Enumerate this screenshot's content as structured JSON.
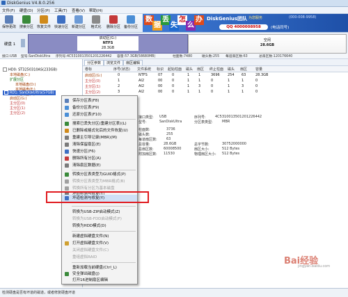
{
  "window": {
    "title": "DiskGenius V4.8.0.256"
  },
  "menu": [
    "文件(F)",
    "硬盘(D)",
    "分区(P)",
    "工具(T)",
    "查看(V)",
    "帮助(H)"
  ],
  "toolbar": [
    {
      "label": "保存更改",
      "icon": "save-icon",
      "color": "#5b7fb8"
    },
    {
      "label": "搜索分区",
      "icon": "search-partition-icon",
      "color": "#3a8a3a"
    },
    {
      "label": "恢复文件",
      "icon": "recover-files-icon",
      "color": "#d08a1a"
    },
    {
      "label": "快速分区",
      "icon": "quick-partition-icon",
      "color": "#3d6fc2"
    },
    {
      "label": "新建分区",
      "icon": "new-partition-icon",
      "color": "#6c9ad6"
    },
    {
      "label": "格式化",
      "icon": "format-icon",
      "color": "#8a8a8a"
    },
    {
      "label": "删除分区",
      "icon": "delete-partition-icon",
      "color": "#c43a3a"
    },
    {
      "label": "备份分区",
      "icon": "backup-partition-icon",
      "color": "#4a8ed6"
    }
  ],
  "banner": {
    "tiles": [
      "数",
      "据",
      "丢",
      "失",
      "怎",
      "么",
      "办"
    ],
    "brand": "DiskGenius团队",
    "sub": "为您服务",
    "qq_prefix": "QQ",
    "qq": "4000008958",
    "tel": "(电话同号)",
    "tel_small": "(000-008-9958)"
  },
  "diskmap": {
    "disk_label": "硬盘 1",
    "part1": {
      "name": "启动区(G:)",
      "fs": "NTFS",
      "size": "28.3GB"
    },
    "part2": {
      "name": "空闲",
      "size": "28.6GB"
    }
  },
  "infobar": [
    "接口:USB",
    "型号:SanDiskUltra",
    "序列号:4C5310013501201226442",
    "容量:57.3GB(58680MB)",
    "柱面数:7480",
    "磁头数:255",
    "每道扇区数:63",
    "总扇区数:120176640"
  ],
  "tree": {
    "disk0": "HD0: ST3250310AS(233GB)",
    "d0_items": [
      "本地磁盘(C:)",
      "扩展分区",
      "本地磁盘(D:)",
      "本地磁盘(E:)",
      "本地磁盘(F:)"
    ],
    "disk1": "RD1: SanDiskUltra(57GB)",
    "d1_items": [
      "启动区(G:)",
      "主分区(0)",
      "主分区(1)",
      "主分区(2)"
    ]
  },
  "tabs": [
    "分区参数",
    "浏览文件",
    "扇区编辑"
  ],
  "table": {
    "headers": [
      "卷标",
      "序号(状态)",
      "文件系统",
      "标识",
      "起始柱面",
      "磁头",
      "扇区",
      "终止柱面",
      "磁头",
      "扇区",
      "容量"
    ],
    "rows": [
      [
        "启动区(G:)",
        "0",
        "NTFS",
        "07",
        "0",
        "1",
        "1",
        "3696",
        "254",
        "63",
        "28.3GB"
      ],
      [
        "主分区(0)",
        "1",
        "AI2",
        "00",
        "0",
        "1",
        "1",
        "0",
        "1",
        "1",
        "0"
      ],
      [
        "主分区(1)",
        "2",
        "AI2",
        "00",
        "0",
        "1",
        "3",
        "0",
        "1",
        "3",
        "0"
      ],
      [
        "主分区(2)",
        "3",
        "AI2",
        "00",
        "0",
        "1",
        "1",
        "0",
        "1",
        "1",
        "0"
      ]
    ]
  },
  "details": [
    {
      "l": "接口类型:",
      "v": "USB"
    },
    {
      "l": "型号:",
      "v": "SanDiskUltra"
    },
    {
      "l": "柱面数:",
      "v": "3736"
    },
    {
      "l": "磁头数:",
      "v": "255"
    },
    {
      "l": "每道扇区数:",
      "v": "63"
    },
    {
      "l": "总容量:",
      "v": "28.6GB"
    },
    {
      "l": "总扇区数:",
      "v": "60008500"
    },
    {
      "l": "附加扇区数:",
      "v": "11530"
    },
    {
      "l": "序列号:",
      "v": "4C5310013501201226442"
    },
    {
      "l": "分区表类型:",
      "v": "MBR"
    },
    {
      "l": "总字节数:",
      "v": "30752000000"
    },
    {
      "l": "扇区大小:",
      "v": "512 Bytes"
    },
    {
      "l": "物理扇区大小:",
      "v": "512 Bytes"
    }
  ],
  "context_menu": [
    {
      "label": "保存分区表(F8)",
      "enabled": true,
      "icon": "save-icon",
      "color": "#5b7fb8"
    },
    {
      "label": "备份分区表(F9)",
      "enabled": true,
      "icon": "backup-icon",
      "color": "#4a8ed6"
    },
    {
      "label": "还原分区表(F10)",
      "enabled": true,
      "icon": "restore-icon",
      "color": "#4a8ed6"
    },
    {
      "sep": true
    },
    {
      "label": "搜索已丢失分区(重建分区表)(L)",
      "enabled": true,
      "icon": "search-icon",
      "color": "#3a8a3a"
    },
    {
      "label": "已删除或格式化后的文件恢复(U)",
      "enabled": true,
      "icon": "recover-icon",
      "color": "#d08a1a"
    },
    {
      "label": "重建主引导记录(MBR)(M)",
      "enabled": true,
      "icon": "mbr-icon",
      "color": "#7a7a7a"
    },
    {
      "label": "清除保留扇区(E)",
      "enabled": true,
      "icon": "clear-icon",
      "color": "#7a7a7a"
    },
    {
      "label": "快速分区(F6)",
      "enabled": true,
      "icon": "quick-partition-icon",
      "color": "#3d6fc2"
    },
    {
      "label": "删除所有分区(A)",
      "enabled": true,
      "icon": "delete-icon",
      "color": "#c43a3a"
    },
    {
      "label": "清除扇区数据(E)",
      "enabled": true,
      "icon": "erase-icon",
      "color": "#7a7a7a"
    },
    {
      "sep": true
    },
    {
      "label": "转换分区表类型为GUID格式(P)",
      "enabled": true,
      "icon": "convert-icon",
      "color": "#3a8a3a"
    },
    {
      "label": "转换分区表类型为MBR格式(B)",
      "enabled": false,
      "icon": "convert-mbr-icon",
      "color": "#a0a0a0"
    },
    {
      "label": "转换所有分区为基本磁盘",
      "enabled": false,
      "icon": "convert-basic-icon",
      "color": "#a0a0a0"
    },
    {
      "label": "坏道检测与修复(Y)",
      "enabled": true,
      "icon": "chart-icon",
      "color": "#7a7a7a"
    },
    {
      "label": "坏道检测与修复(Y)",
      "enabled": true,
      "icon": "wrench-icon",
      "color": "#3d6fc2",
      "hot": true
    },
    {
      "sep": true
    },
    {
      "label": "转换为USB-ZIP启动模式(Z)",
      "enabled": true,
      "icon": "",
      "color": ""
    },
    {
      "label": "转换为USB-FDD启动模式(F)",
      "enabled": false,
      "icon": "",
      "color": ""
    },
    {
      "label": "转换为HDD模式(D)",
      "enabled": true,
      "icon": "",
      "color": ""
    },
    {
      "sep": true
    },
    {
      "label": "新建虚拟硬盘文件(N)",
      "enabled": true,
      "icon": "",
      "color": ""
    },
    {
      "label": "打开虚拟硬盘文件(V)",
      "enabled": true,
      "icon": "open-icon",
      "color": "#d0a030"
    },
    {
      "label": "关闭虚拟硬盘文件(C)",
      "enabled": false,
      "icon": "",
      "color": ""
    },
    {
      "label": "重组虚拟RAID",
      "enabled": false,
      "icon": "",
      "color": ""
    },
    {
      "sep": true
    },
    {
      "label": "重新加载当前硬盘(Ctrl_L)",
      "enabled": true,
      "icon": "",
      "color": ""
    },
    {
      "label": "安全弹出磁盘(J)",
      "enabled": true,
      "icon": "eject-icon",
      "color": "#3a8a3a"
    },
    {
      "label": "打开16进制扇区编辑",
      "enabled": true,
      "icon": "",
      "color": ""
    }
  ],
  "status": "检测硬盘是否有坏道的磁道，或者修复硬盘坏道",
  "watermark": {
    "main": "Bai经验",
    "sub": "jingyan.baidu.com"
  }
}
